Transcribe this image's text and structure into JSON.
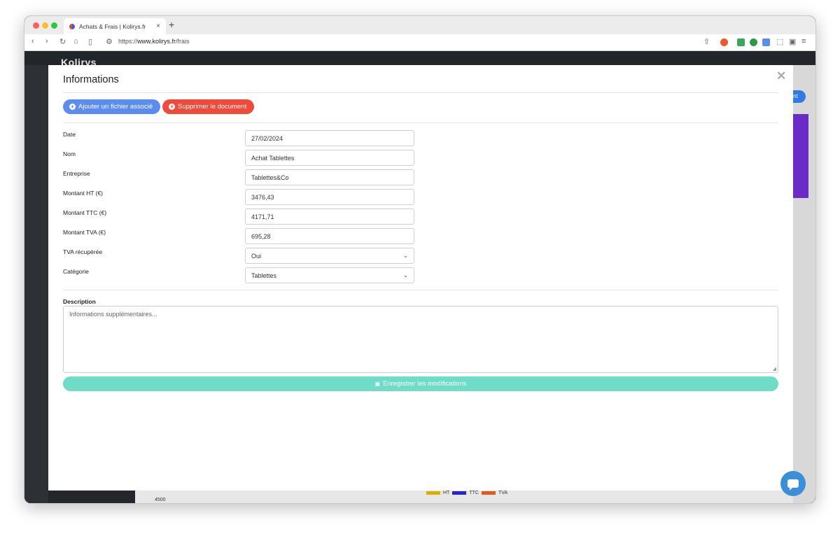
{
  "browser": {
    "tab_title": "Achats & Frais | Kolirys.fr",
    "tab_close": "×",
    "new_tab": "+",
    "url_prefix": "https://",
    "url_host": "www.kolirys.fr",
    "url_path": "/frais"
  },
  "app": {
    "brand": "Kolirys",
    "right_button": "nt",
    "chart_legend": [
      "HT",
      "TTC",
      "TVA"
    ],
    "chart_axis_tick": "4500",
    "legend_colors": [
      "#d8b000",
      "#2a1fd1",
      "#e25a1a"
    ]
  },
  "modal": {
    "title": "Informations",
    "close": "✕",
    "actions": {
      "add_file": "Ajouter un fichier associé",
      "delete_doc": "Supprimer le document"
    },
    "fields": [
      {
        "label": "Date",
        "value": "27/02/2024"
      },
      {
        "label": "Nom",
        "value": "Achat Tablettes"
      },
      {
        "label": "Entreprise",
        "value": "Tablettes&Co"
      },
      {
        "label": "Montant HT (€)",
        "value": "3476,43"
      },
      {
        "label": "Montant TTC (€)",
        "value": "4171,71"
      },
      {
        "label": "Montant TVA (€)",
        "value": "695,28"
      },
      {
        "label": "TVA récupérée",
        "value": "Oui"
      },
      {
        "label": "Catégorie",
        "value": "Tablettes"
      }
    ],
    "description": {
      "label": "Description",
      "placeholder": "Informations supplémentaires..."
    },
    "save": "Enregistrer les modifications"
  },
  "colors": {
    "accent_blue": "#5b8def",
    "danger_red": "#ef4a3c",
    "save_teal": "#6fdcc7",
    "chat_blue": "#3a8fd8"
  }
}
